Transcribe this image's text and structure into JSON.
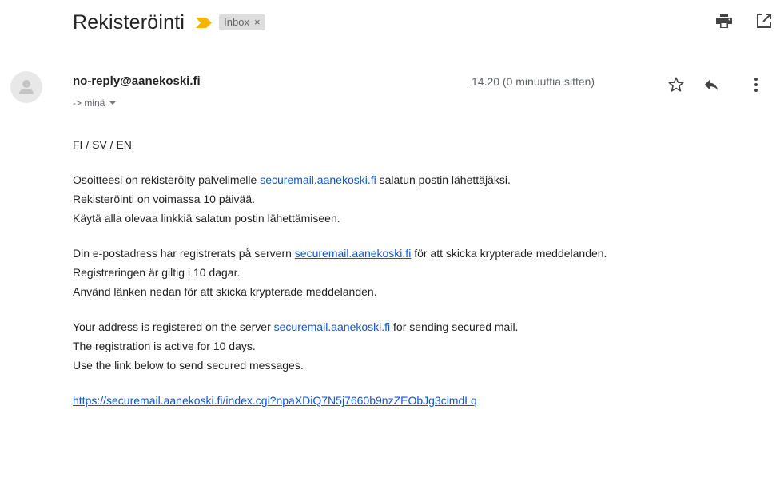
{
  "subject": "Rekisteröinti",
  "label": {
    "text": "Inbox",
    "remove": "×"
  },
  "header_icons": [
    "print-icon",
    "open-in-new-window-icon"
  ],
  "sender": {
    "email": "no-reply@aanekoski.fi",
    "to": "-> minä",
    "time": "14.20 (0 minuuttia sitten)"
  },
  "message_icons": [
    "star-icon",
    "reply-icon",
    "more-vert-icon"
  ],
  "colors": {
    "importance": "#f4b400",
    "link": "#1155cc",
    "chip_bg": "#dddddd"
  },
  "body": {
    "langs": "FI / SV / EN",
    "fi": {
      "l1_pre": "Osoitteesi on rekisteröity palvelimelle ",
      "l1_link": "securemail.aanekoski.fi",
      "l1_post": " salatun postin lähettäjäksi.",
      "l2": "Rekisteröinti on voimassa 10 päivää.",
      "l3": "Käytä alla olevaa linkkiä salatun postin lähettämiseen."
    },
    "sv": {
      "l1_pre": "Din e-postadress har registrerats på servern ",
      "l1_link": "securemail.aanekoski.fi",
      "l1_post": " för att skicka krypterade meddelanden.",
      "l2": "Registreringen är giltig i 10 dagar.",
      "l3": "Använd länken nedan för att skicka krypterade meddelanden."
    },
    "en": {
      "l1_pre": "Your address is registered on the server ",
      "l1_link": "securemail.aanekoski.fi",
      "l1_post": " for sending secured mail.",
      "l2": "The registration is active for 10 days.",
      "l3": "Use the link below to send secured messages."
    },
    "link_url": "https://securemail.aanekoski.fi/index.cgi?npaXDiQ7N5j7660b9nzZEObJg3cimdLq"
  }
}
